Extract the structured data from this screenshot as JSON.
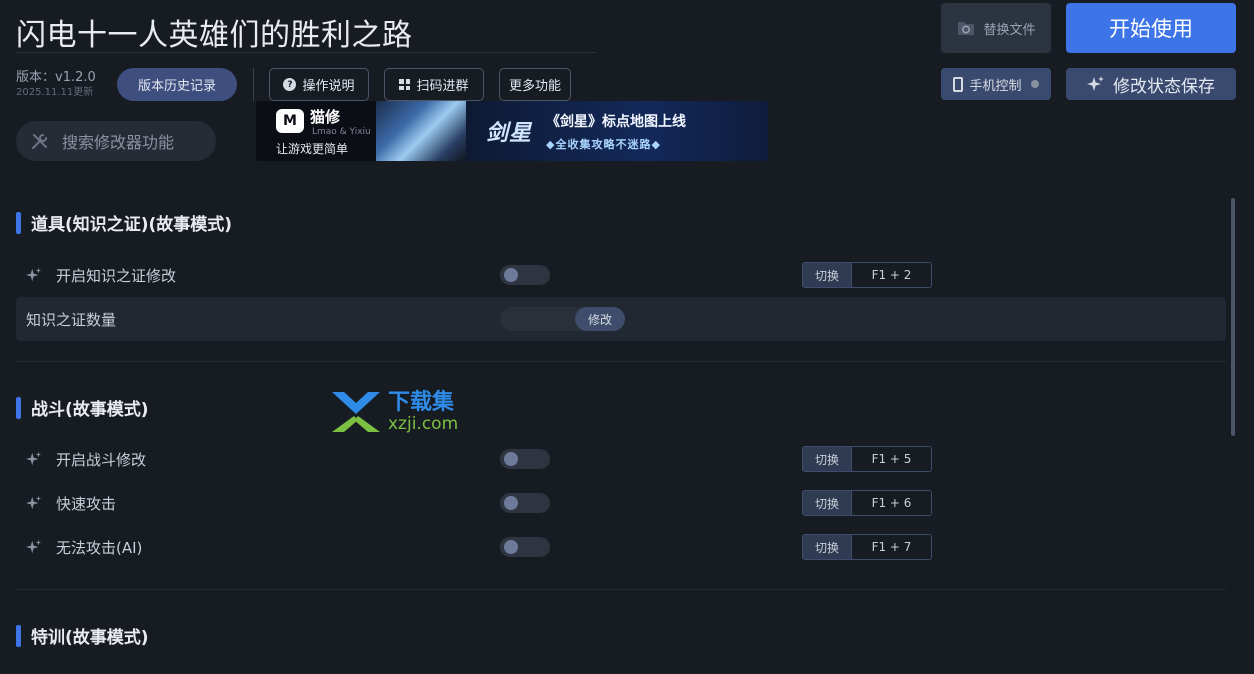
{
  "header": {
    "title": "闪电十一人英雄们的胜利之路",
    "version": "版本：v1.2.0",
    "update_date": "2025.11.11更新",
    "history_button": "版本历史记录",
    "help_button": "操作说明",
    "scan_button": "扫码进群",
    "more_button": "更多功能",
    "replace_file_button": "替换文件",
    "start_button": "开始使用",
    "phone_control_button": "手机控制",
    "save_state_button": "修改状态保存"
  },
  "search": {
    "placeholder": "搜索修改器功能"
  },
  "banner": {
    "brand_name": "猫修",
    "brand_sub": "Lmao & Yixiu",
    "slogan": "让游戏更简单",
    "game_logo": "剑星",
    "headline": "《剑星》标点地图上线",
    "subline": "◆全收集攻略不迷路◆"
  },
  "sections": [
    {
      "title": "道具(知识之证)(故事模式)",
      "rows": [
        {
          "type": "toggle",
          "label": "开启知识之证修改",
          "enabled": false,
          "hotkey_mode": "切换",
          "hotkey": "F1 + 2"
        },
        {
          "type": "number",
          "label": "知识之证数量",
          "button": "修改"
        }
      ]
    },
    {
      "title": "战斗(故事模式)",
      "rows": [
        {
          "type": "toggle",
          "label": "开启战斗修改",
          "enabled": false,
          "hotkey_mode": "切换",
          "hotkey": "F1 + 5"
        },
        {
          "type": "toggle",
          "label": "快速攻击",
          "enabled": false,
          "hotkey_mode": "切换",
          "hotkey": "F1 + 6"
        },
        {
          "type": "toggle",
          "label": "无法攻击(AI)",
          "enabled": false,
          "hotkey_mode": "切换",
          "hotkey": "F1 + 7"
        }
      ]
    },
    {
      "title": "特训(故事模式)",
      "rows": []
    }
  ],
  "watermark": {
    "name": "下载集",
    "url": "xzji.com"
  },
  "icons": {
    "help": "question-circle-icon",
    "scan": "qr-code-icon",
    "search": "wrench-icon",
    "replace": "file-swap-icon",
    "phone": "phone-icon",
    "save": "sparkle-icon",
    "row": "sparkle-icon"
  },
  "colors": {
    "background": "#171b22",
    "accent": "#3d74e8",
    "history_button": "#3e4f7f",
    "toggle_off": "#2f3540"
  }
}
